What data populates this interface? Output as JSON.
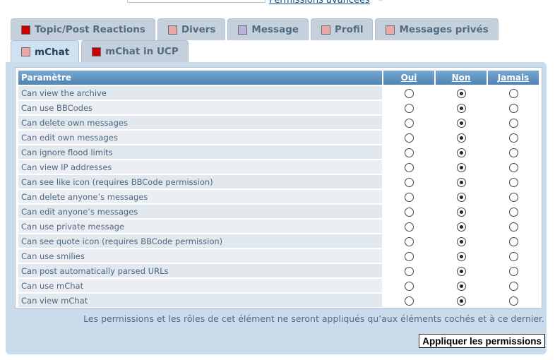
{
  "header": {
    "advanced_link": "Permissions avancées",
    "star": "*"
  },
  "colors": {
    "swatch_red": "#cc0000",
    "swatch_pink": "#e9a7a9",
    "swatch_violet": "#b9b4dc"
  },
  "tabs_row1": [
    {
      "label": "Topic/Post Reactions",
      "swatch": "#cc0000"
    },
    {
      "label": "Divers",
      "swatch": "#e9a7a9"
    },
    {
      "label": "Message",
      "swatch": "#b9b4dc"
    },
    {
      "label": "Profil",
      "swatch": "#e9a7a9"
    },
    {
      "label": "Messages privés",
      "swatch": "#e9a7a9"
    }
  ],
  "tabs_row2": [
    {
      "label": "mChat",
      "swatch": "#e9a7a9",
      "active": true
    },
    {
      "label": "mChat in UCP",
      "swatch": "#cc0000",
      "active": false
    }
  ],
  "table": {
    "headers": {
      "setting": "Paramètre",
      "yes": "Oui",
      "no": "Non",
      "never": "Jamais"
    },
    "rows": [
      {
        "label": "Can view the archive",
        "selected": "no"
      },
      {
        "label": "Can use BBCodes",
        "selected": "no"
      },
      {
        "label": "Can delete own messages",
        "selected": "no"
      },
      {
        "label": "Can edit own messages",
        "selected": "no"
      },
      {
        "label": "Can ignore flood limits",
        "selected": "no"
      },
      {
        "label": "Can view IP addresses",
        "selected": "no"
      },
      {
        "label": "Can see like icon (requires BBCode permission)",
        "selected": "no"
      },
      {
        "label": "Can delete anyone’s messages",
        "selected": "no"
      },
      {
        "label": "Can edit anyone’s messages",
        "selected": "no"
      },
      {
        "label": "Can use private message",
        "selected": "no"
      },
      {
        "label": "Can see quote icon (requires BBCode permission)",
        "selected": "no"
      },
      {
        "label": "Can use smilies",
        "selected": "no"
      },
      {
        "label": "Can post automatically parsed URLs",
        "selected": "no"
      },
      {
        "label": "Can use mChat",
        "selected": "no"
      },
      {
        "label": "Can view mChat",
        "selected": "no"
      }
    ]
  },
  "footer": {
    "note": "Les permissions et les rôles de cet élément ne seront appliqués qu’aux éléments cochés et à ce dernier.",
    "apply_label": "Appliquer les permissions"
  }
}
